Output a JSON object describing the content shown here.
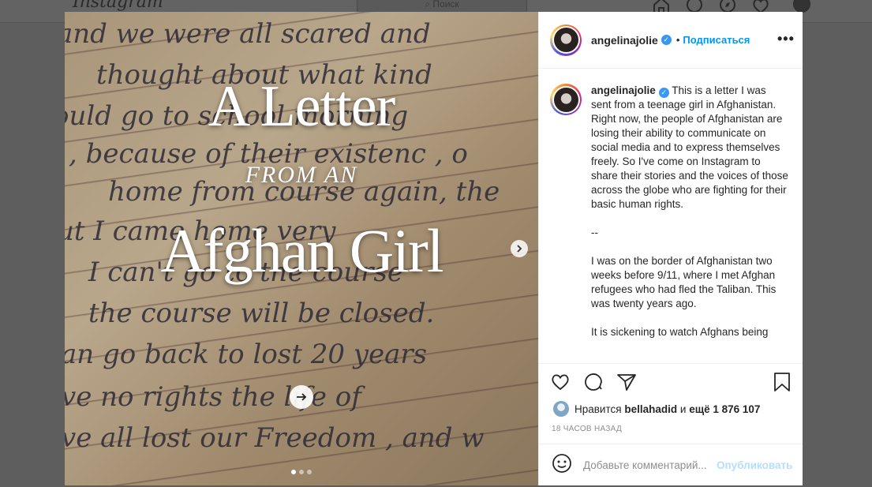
{
  "topbar": {
    "logo": "Instagram",
    "search_placeholder": "Поиск"
  },
  "slide": {
    "title_line1": "A Letter",
    "title_line2": "FROM  AN",
    "title_line3": "Afghan Girl",
    "handwriting": [
      "and  we  were  all  scared  and",
      "thought  about  what  kind",
      "ould  go  to  school  morning",
      ", because  of  their  existenc , o",
      "home  from  course  again,  the",
      "ut  I  came  home  very",
      "I  can't  go  to  the  course",
      "the  course  will  be  closed.",
      "an  go  back  to  lost  20  years",
      "ve  no  rights  the  life  of",
      "ve  all  lost  our  Freedom ,  and  w"
    ],
    "slide_count": 3,
    "active_slide": 1
  },
  "post": {
    "username": "angelinajolie",
    "follow_label": "Подписаться",
    "separator": "•",
    "more_label": "•••",
    "caption": "This is a letter I was sent from a teenage girl in Afghanistan. Right now, the people of Afghanistan are losing their ability to communicate on social media and to express themselves freely. So I've come on Instagram to share their stories and the voices of those across the globe who are fighting for their basic human rights.\n\n--\n\nI was on the border of Afghanistan two weeks before 9/11, where I met Afghan refugees who had fled the Taliban. This was twenty years ago.\n\nIt is sickening to watch Afghans being",
    "likes_prefix": "Нравится",
    "likes_user": "bellahadid",
    "likes_and": "и",
    "likes_count": "ещё 1 876 107",
    "timestamp": "18 ЧАСОВ НАЗАД",
    "comment_placeholder": "Добавьте комментарий...",
    "publish_label": "Опубликовать"
  },
  "colors": {
    "accent": "#0095f6",
    "publish_disabled": "#b2dffc",
    "overlay": "#5e5e5e"
  }
}
